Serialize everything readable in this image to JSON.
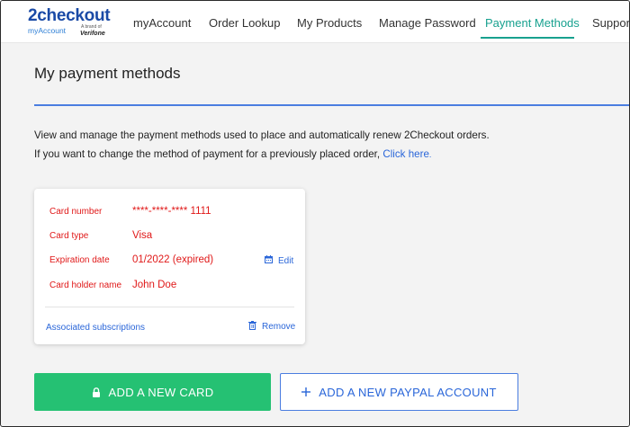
{
  "brand": {
    "name": "2checkout",
    "sub": "myAccount",
    "by": "A brand of",
    "partner": "Verifone"
  },
  "nav": {
    "items": [
      {
        "label": "myAccount"
      },
      {
        "label": "Order Lookup"
      },
      {
        "label": "My Products"
      },
      {
        "label": "Manage Password"
      },
      {
        "label": "Payment Methods",
        "active": true
      },
      {
        "label": "Support"
      }
    ]
  },
  "page": {
    "title": "My payment methods",
    "desc_line1": "View and manage the payment methods used to place and automatically renew 2Checkout orders.",
    "desc_line2": "If you want to change the method of payment for a previously placed order,",
    "click_here": "Click here",
    "click_here_suffix": "."
  },
  "card": {
    "fields": [
      {
        "label": "Card number",
        "value": "****-****-**** 1111"
      },
      {
        "label": "Card type",
        "value": "Visa"
      },
      {
        "label": "Expiration date",
        "value": "01/2022 (expired)"
      },
      {
        "label": "Card holder name",
        "value": "John Doe"
      }
    ],
    "edit_label": "Edit",
    "associated_label": "Associated subscriptions",
    "remove_label": "Remove",
    "error_color": "#e01818"
  },
  "actions": {
    "add_card_label": "ADD A NEW CARD",
    "add_paypal_label": "ADD A NEW PAYPAL ACCOUNT",
    "add_card_icon": "lock-icon",
    "add_paypal_icon": "plus-icon"
  },
  "colors": {
    "accent": "#18a18f",
    "link": "#2a66d9",
    "primary_button": "#25c173",
    "rule": "#4a7de0"
  }
}
